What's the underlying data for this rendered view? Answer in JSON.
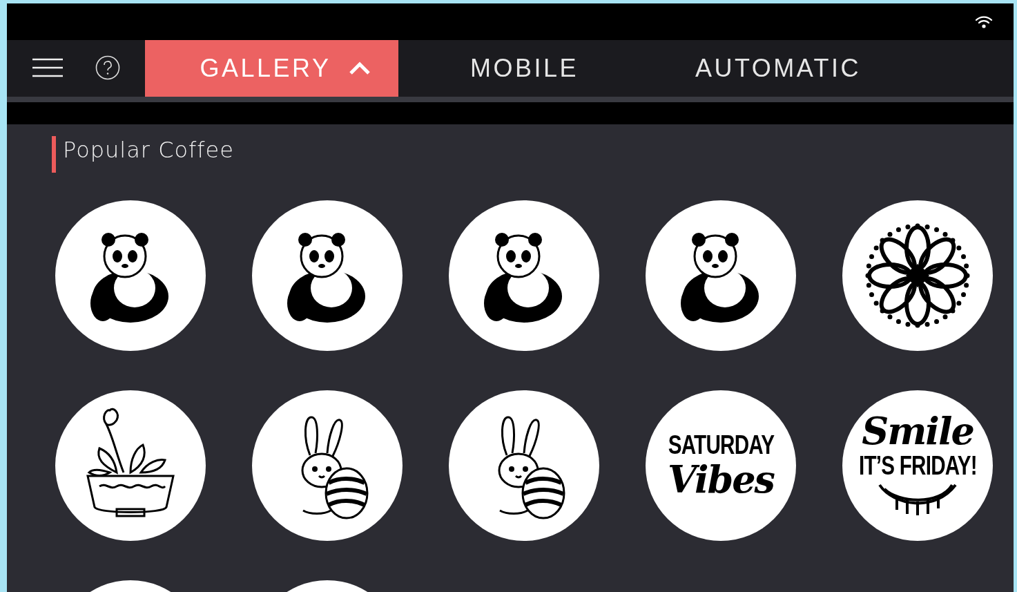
{
  "nav": {
    "tabs": [
      {
        "label": "GALLERY",
        "selected": true
      },
      {
        "label": "MOBILE",
        "selected": false
      },
      {
        "label": "AUTOMATIC",
        "selected": false
      }
    ]
  },
  "section": {
    "title": "Popular Coffee",
    "designs": [
      {
        "kind": "panda"
      },
      {
        "kind": "panda"
      },
      {
        "kind": "panda"
      },
      {
        "kind": "panda"
      },
      {
        "kind": "mandala"
      },
      {
        "kind": "plant"
      },
      {
        "kind": "bunny"
      },
      {
        "kind": "bunny"
      },
      {
        "kind": "lettering",
        "grin": false,
        "lines": [
          {
            "text": "SATURDAY",
            "kind": "block"
          },
          {
            "text": "Vibes",
            "kind": "script"
          }
        ]
      },
      {
        "kind": "lettering",
        "grin": true,
        "lines": [
          {
            "text": "Smile",
            "kind": "script"
          },
          {
            "text": "IT’S FRIDAY!",
            "kind": "block"
          }
        ]
      },
      {
        "kind": "blank"
      },
      {
        "kind": "blank"
      }
    ]
  }
}
